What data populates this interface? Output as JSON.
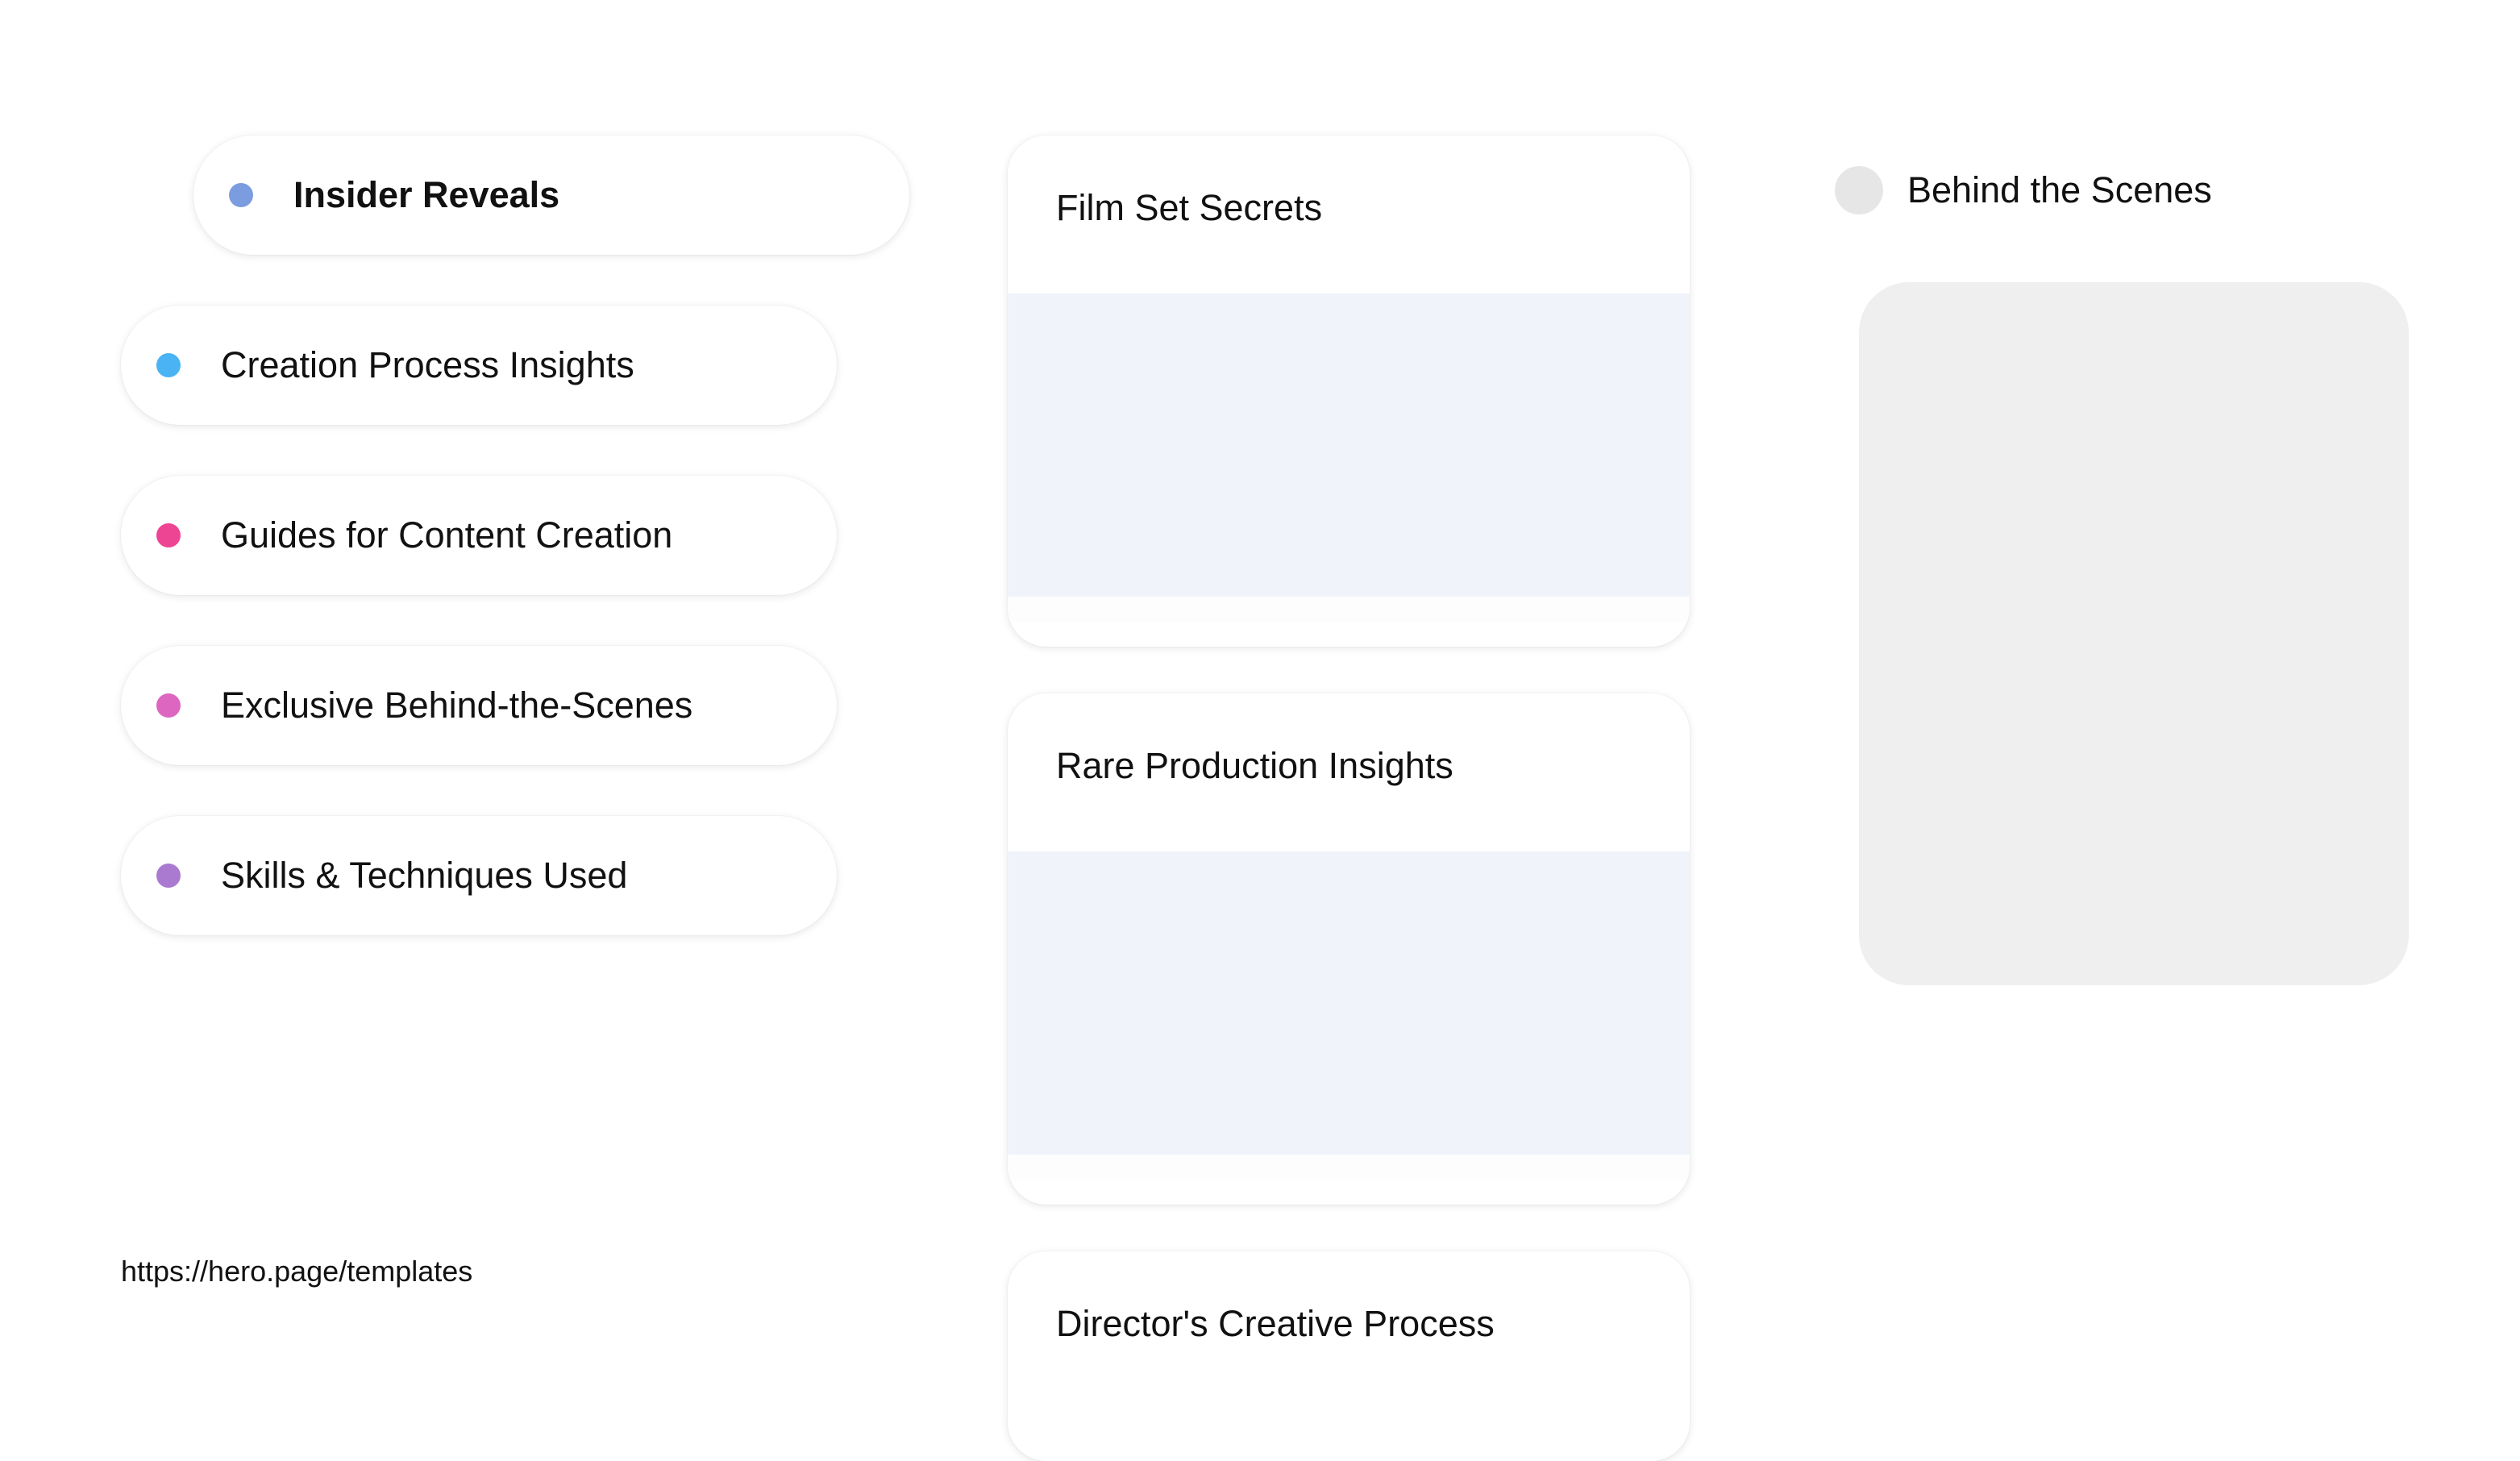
{
  "menu": {
    "items": [
      {
        "label": "Insider Reveals",
        "color": "#7b9de0",
        "active": true
      },
      {
        "label": "Creation Process Insights",
        "color": "#4ab3f4"
      },
      {
        "label": "Guides for Content Creation",
        "color": "#ee4494"
      },
      {
        "label": "Exclusive Behind-the-Scenes",
        "color": "#dd66c0"
      },
      {
        "label": "Skills & Techniques Used",
        "color": "#a97ad0"
      }
    ]
  },
  "cards": [
    {
      "title": "Film Set Secrets"
    },
    {
      "title": "Rare Production Insights"
    },
    {
      "title": "Director's Creative Process"
    }
  ],
  "preview": {
    "title": "Behind the Scenes"
  },
  "footer": {
    "url": "https://hero.page/templates"
  }
}
